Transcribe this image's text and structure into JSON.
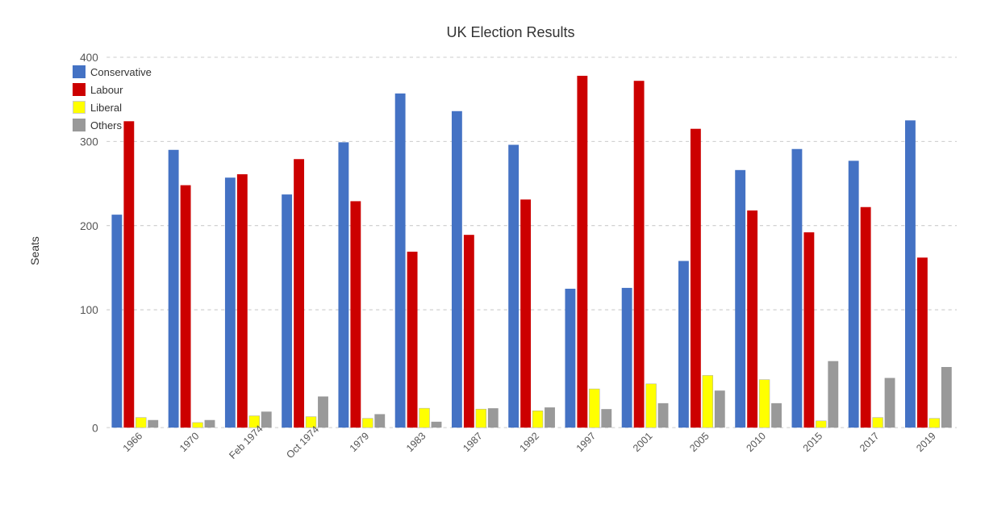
{
  "title": "UK Election Results",
  "yAxisLabel": "Seats",
  "legend": [
    {
      "label": "Conservative",
      "color": "#4472C4"
    },
    {
      "label": "Labour",
      "color": "#CC0000"
    },
    {
      "label": "Liberal",
      "color": "#FFFF00"
    },
    {
      "label": "Others",
      "color": "#999999"
    }
  ],
  "elections": [
    {
      "year": "1966",
      "con": 253,
      "lab": 364,
      "lib": 12,
      "oth": 9
    },
    {
      "year": "1970",
      "con": 330,
      "lab": 288,
      "lib": 6,
      "oth": 9
    },
    {
      "year": "Feb 1974",
      "con": 297,
      "lab": 301,
      "lib": 14,
      "oth": 19
    },
    {
      "year": "Oct 1974",
      "con": 277,
      "lab": 319,
      "lib": 13,
      "oth": 37
    },
    {
      "year": "1979",
      "con": 339,
      "lab": 269,
      "lib": 11,
      "oth": 16
    },
    {
      "year": "1983",
      "con": 397,
      "lab": 209,
      "lib": 23,
      "oth": 7
    },
    {
      "year": "1987",
      "con": 376,
      "lab": 229,
      "lib": 22,
      "oth": 23
    },
    {
      "year": "1992",
      "con": 336,
      "lab": 271,
      "lib": 20,
      "oth": 24
    },
    {
      "year": "1997",
      "con": 165,
      "lab": 418,
      "lib": 46,
      "oth": 22
    },
    {
      "year": "2001",
      "con": 166,
      "lab": 412,
      "lib": 52,
      "oth": 29
    },
    {
      "year": "2005",
      "con": 198,
      "lab": 355,
      "lib": 62,
      "oth": 44
    },
    {
      "year": "2010",
      "con": 306,
      "lab": 258,
      "lib": 57,
      "oth": 29
    },
    {
      "year": "2015",
      "con": 331,
      "lab": 232,
      "lib": 8,
      "oth": 79
    },
    {
      "year": "2017",
      "con": 317,
      "lab": 262,
      "lib": 12,
      "oth": 59
    },
    {
      "year": "2019",
      "con": 365,
      "lab": 202,
      "lib": 11,
      "oth": 72
    }
  ],
  "colors": {
    "conservative": "#4472C4",
    "labour": "#CC0000",
    "liberal": "#FFFF00",
    "others": "#999999"
  },
  "yMax": 440,
  "yTicks": [
    0,
    100,
    200,
    300,
    400
  ]
}
